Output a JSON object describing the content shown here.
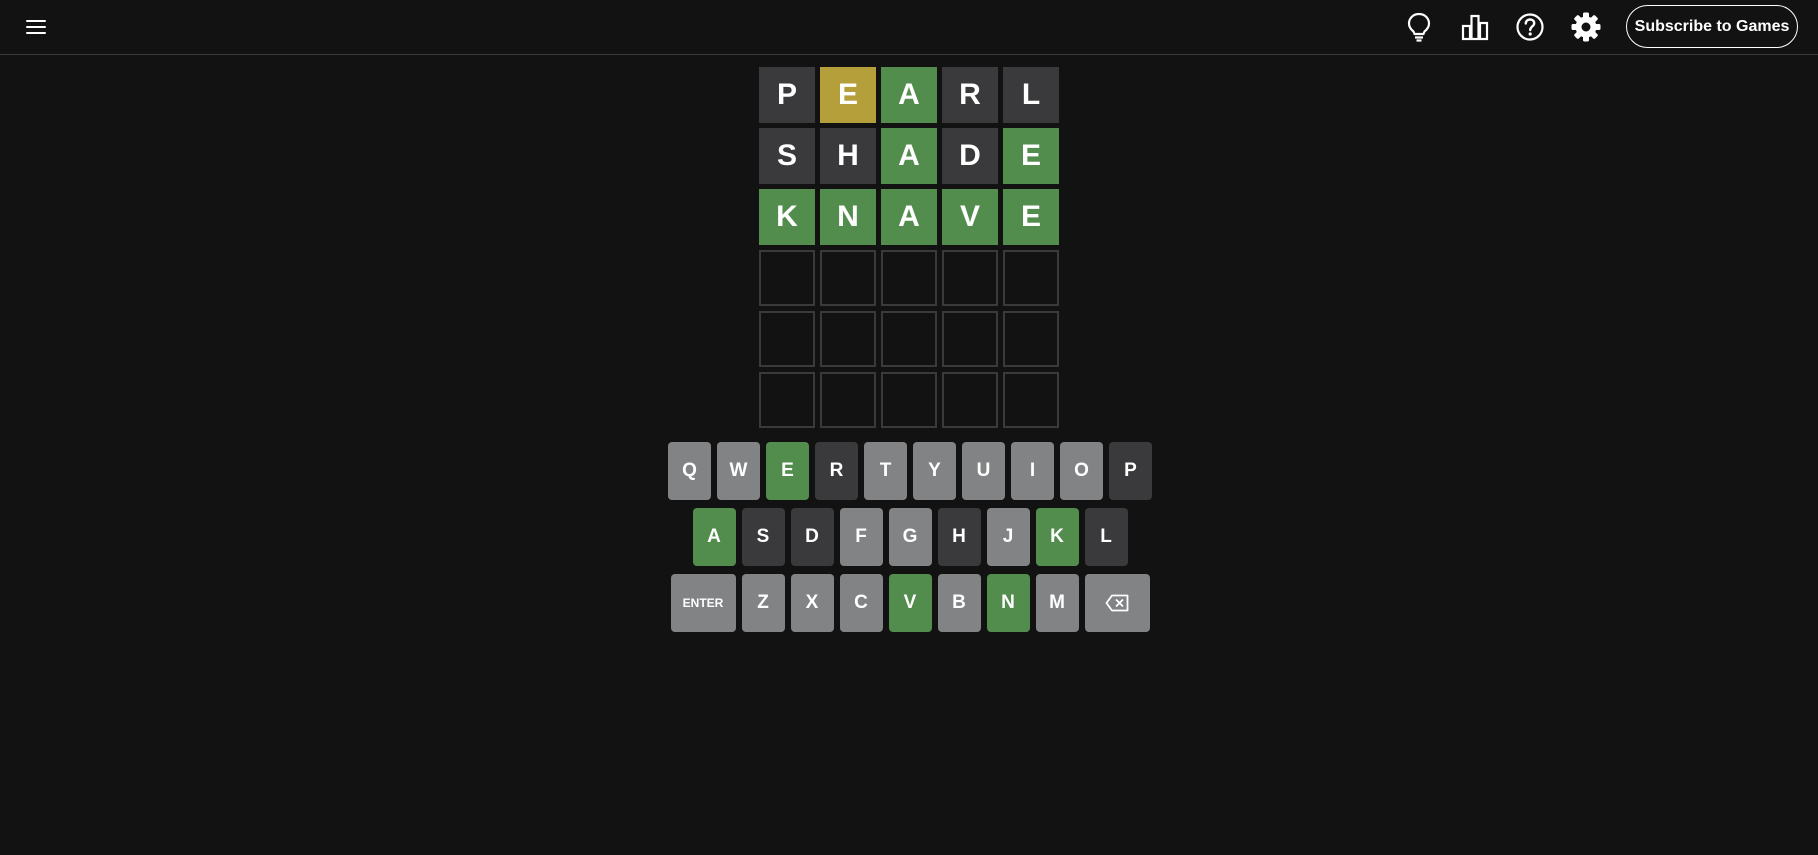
{
  "header": {
    "menu_icon": "hamburger-menu-icon",
    "icons": [
      "lightbulb-icon",
      "stats-bar-chart-icon",
      "help-question-icon",
      "settings-gear-icon"
    ],
    "subscribe_label": "Subscribe to Games"
  },
  "colors": {
    "background": "#121213",
    "correct": "#538d4e",
    "present": "#b59f3b",
    "absent": "#3a3a3c",
    "unused_key": "#818384",
    "empty_border": "#3a3a3c"
  },
  "board": {
    "rows": [
      [
        {
          "letter": "P",
          "state": "absent"
        },
        {
          "letter": "E",
          "state": "present"
        },
        {
          "letter": "A",
          "state": "correct"
        },
        {
          "letter": "R",
          "state": "absent"
        },
        {
          "letter": "L",
          "state": "absent"
        }
      ],
      [
        {
          "letter": "S",
          "state": "absent"
        },
        {
          "letter": "H",
          "state": "absent"
        },
        {
          "letter": "A",
          "state": "correct"
        },
        {
          "letter": "D",
          "state": "absent"
        },
        {
          "letter": "E",
          "state": "correct"
        }
      ],
      [
        {
          "letter": "K",
          "state": "correct"
        },
        {
          "letter": "N",
          "state": "correct"
        },
        {
          "letter": "A",
          "state": "correct"
        },
        {
          "letter": "V",
          "state": "correct"
        },
        {
          "letter": "E",
          "state": "correct"
        }
      ],
      [
        {
          "letter": "",
          "state": "empty"
        },
        {
          "letter": "",
          "state": "empty"
        },
        {
          "letter": "",
          "state": "empty"
        },
        {
          "letter": "",
          "state": "empty"
        },
        {
          "letter": "",
          "state": "empty"
        }
      ],
      [
        {
          "letter": "",
          "state": "empty"
        },
        {
          "letter": "",
          "state": "empty"
        },
        {
          "letter": "",
          "state": "empty"
        },
        {
          "letter": "",
          "state": "empty"
        },
        {
          "letter": "",
          "state": "empty"
        }
      ],
      [
        {
          "letter": "",
          "state": "empty"
        },
        {
          "letter": "",
          "state": "empty"
        },
        {
          "letter": "",
          "state": "empty"
        },
        {
          "letter": "",
          "state": "empty"
        },
        {
          "letter": "",
          "state": "empty"
        }
      ]
    ]
  },
  "keyboard": {
    "rows": [
      [
        {
          "label": "Q",
          "state": "unused"
        },
        {
          "label": "W",
          "state": "unused"
        },
        {
          "label": "E",
          "state": "correct"
        },
        {
          "label": "R",
          "state": "absent"
        },
        {
          "label": "T",
          "state": "unused"
        },
        {
          "label": "Y",
          "state": "unused"
        },
        {
          "label": "U",
          "state": "unused"
        },
        {
          "label": "I",
          "state": "unused"
        },
        {
          "label": "O",
          "state": "unused"
        },
        {
          "label": "P",
          "state": "absent"
        }
      ],
      [
        {
          "label": "A",
          "state": "correct"
        },
        {
          "label": "S",
          "state": "absent"
        },
        {
          "label": "D",
          "state": "absent"
        },
        {
          "label": "F",
          "state": "unused"
        },
        {
          "label": "G",
          "state": "unused"
        },
        {
          "label": "H",
          "state": "absent"
        },
        {
          "label": "J",
          "state": "unused"
        },
        {
          "label": "K",
          "state": "correct"
        },
        {
          "label": "L",
          "state": "absent"
        }
      ],
      [
        {
          "label": "ENTER",
          "state": "unused",
          "wide": true
        },
        {
          "label": "Z",
          "state": "unused"
        },
        {
          "label": "X",
          "state": "unused"
        },
        {
          "label": "C",
          "state": "unused"
        },
        {
          "label": "V",
          "state": "correct"
        },
        {
          "label": "B",
          "state": "unused"
        },
        {
          "label": "N",
          "state": "correct"
        },
        {
          "label": "M",
          "state": "unused"
        },
        {
          "label": "",
          "icon": "backspace-icon",
          "state": "unused",
          "wide": true
        }
      ]
    ]
  }
}
